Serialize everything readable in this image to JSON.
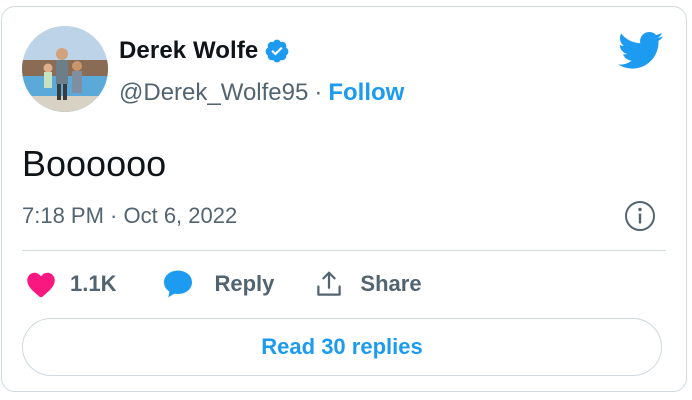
{
  "author": {
    "name": "Derek Wolfe",
    "handle": "@Derek_Wolfe95",
    "separator": "·",
    "follow_label": "Follow"
  },
  "tweet": {
    "text": "Boooooo",
    "timestamp": "7:18 PM · Oct 6, 2022"
  },
  "actions": {
    "like_count": "1.1K",
    "reply_label": "Reply",
    "share_label": "Share"
  },
  "read_replies_label": "Read 30 replies",
  "icons": {
    "verified": "verified-badge-icon",
    "brand": "twitter-bird-icon",
    "info": "info-icon",
    "like": "heart-icon",
    "reply": "speech-bubble-icon",
    "share": "share-upload-icon"
  },
  "colors": {
    "accent": "#1d9bf0",
    "like": "#f91880",
    "text": "#0f1419",
    "muted": "#536471",
    "border": "#cfd9de"
  }
}
